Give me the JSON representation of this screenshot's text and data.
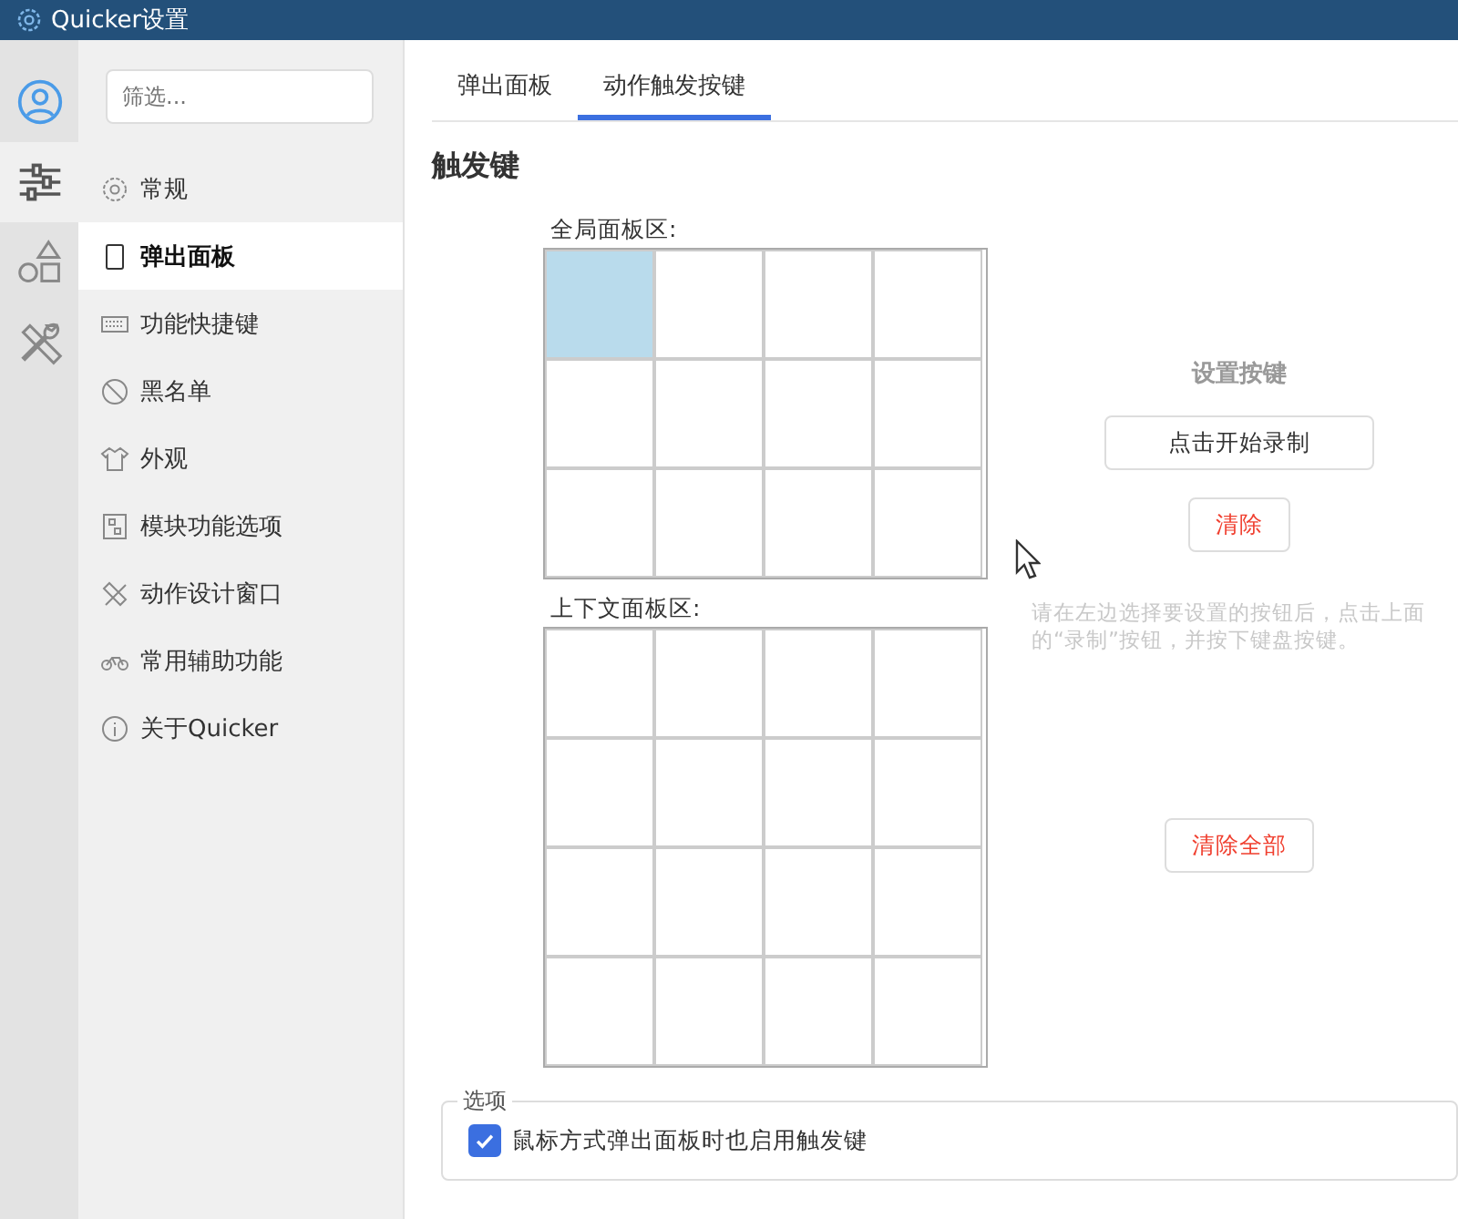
{
  "window": {
    "title": "Quicker设置"
  },
  "rail": [
    {
      "selected": false
    },
    {
      "selected": true
    },
    {
      "selected": false
    },
    {
      "selected": false
    }
  ],
  "filter": {
    "placeholder": "筛选..."
  },
  "nav": [
    {
      "label": "常规",
      "selected": false
    },
    {
      "label": "弹出面板",
      "selected": true
    },
    {
      "label": "功能快捷键",
      "selected": false
    },
    {
      "label": "黑名单",
      "selected": false
    },
    {
      "label": "外观",
      "selected": false
    },
    {
      "label": "模块功能选项",
      "selected": false
    },
    {
      "label": "动作设计窗口",
      "selected": false
    },
    {
      "label": "常用辅助功能",
      "selected": false
    },
    {
      "label": "关于Quicker",
      "selected": false
    }
  ],
  "tabs": [
    {
      "label": "弹出面板",
      "selected": false
    },
    {
      "label": "动作触发按键",
      "selected": true
    }
  ],
  "heading": "触发键",
  "grids": [
    {
      "label": "全局面板区:",
      "rows": [
        [
          {
            "selected": true
          },
          {
            "selected": false
          },
          {
            "selected": false
          },
          {
            "selected": false
          }
        ],
        [
          {
            "selected": false
          },
          {
            "selected": false
          },
          {
            "selected": false
          },
          {
            "selected": false
          }
        ],
        [
          {
            "selected": false
          },
          {
            "selected": false
          },
          {
            "selected": false
          },
          {
            "selected": false
          }
        ]
      ]
    },
    {
      "label": "上下文面板区:",
      "rows": [
        [
          {
            "selected": false
          },
          {
            "selected": false
          },
          {
            "selected": false
          },
          {
            "selected": false
          }
        ],
        [
          {
            "selected": false
          },
          {
            "selected": false
          },
          {
            "selected": false
          },
          {
            "selected": false
          }
        ],
        [
          {
            "selected": false
          },
          {
            "selected": false
          },
          {
            "selected": false
          },
          {
            "selected": false
          }
        ],
        [
          {
            "selected": false
          },
          {
            "selected": false
          },
          {
            "selected": false
          },
          {
            "selected": false
          }
        ]
      ]
    }
  ],
  "key_setting": {
    "title": "设置按键",
    "record_button": "点击开始录制",
    "clear_button": "清除",
    "hint": "请在左边选择要设置的按钮后，点击上面的“录制”按钮，并按下键盘按键。",
    "clear_all_button": "清除全部"
  },
  "options": {
    "legend": "选项",
    "items": [
      {
        "label": "鼠标方式弹出面板时也启用触发键",
        "checked": true
      }
    ]
  }
}
